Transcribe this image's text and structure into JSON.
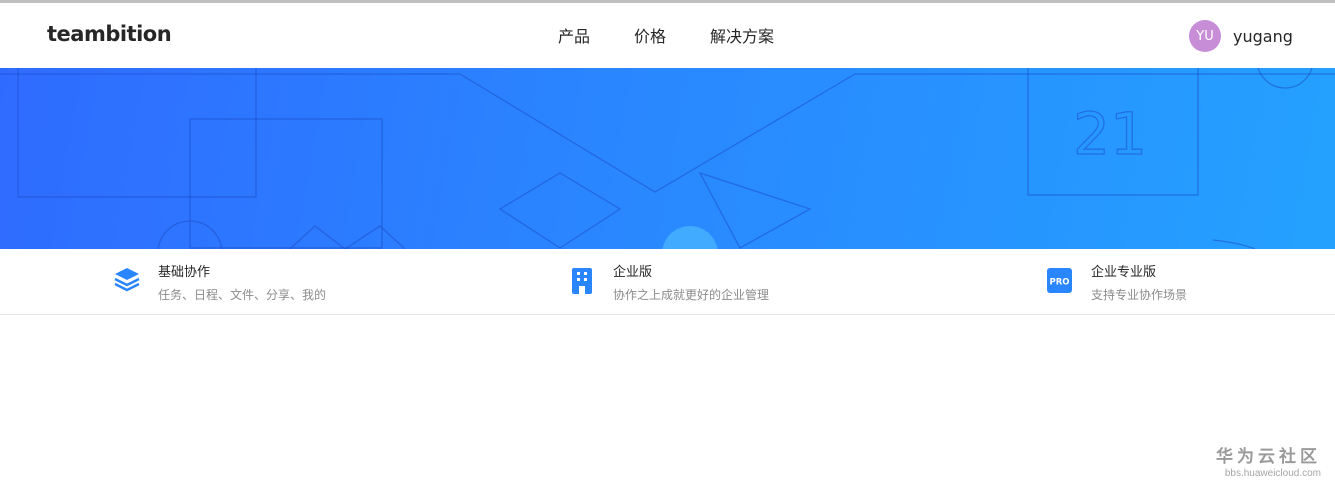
{
  "header": {
    "logo": "teambition",
    "nav": [
      "产品",
      "价格",
      "解决方案"
    ],
    "user": {
      "initials": "YU",
      "name": "yugang",
      "avatar_color": "#c78dd6"
    }
  },
  "hero": {
    "gradient": [
      "#2f6bff",
      "#24a1ff"
    ],
    "calendar_number": "21"
  },
  "features": [
    {
      "title": "基础协作",
      "desc": "任务、日程、文件、分享、我的",
      "icon": "layers-icon"
    },
    {
      "title": "企业版",
      "desc": "协作之上成就更好的企业管理",
      "icon": "building-icon"
    },
    {
      "title": "企业专业版",
      "desc": "支持专业协作场景",
      "icon": "pro-badge-icon",
      "badge_text": "PRO"
    }
  ],
  "watermark": {
    "title": "华为云社区",
    "url": "bbs.huaweicloud.com"
  },
  "colors": {
    "accent": "#2a86ff",
    "text": "#262626",
    "muted": "#8c8c8c"
  }
}
